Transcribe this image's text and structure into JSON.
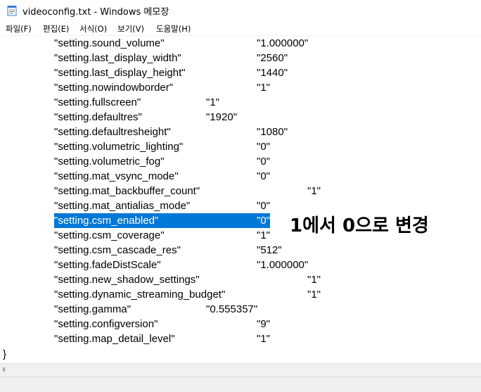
{
  "window": {
    "title": "videoconfig.txt - Windows 메모장",
    "icon": "notepad-icon"
  },
  "menu": [
    {
      "label": "파일(F)"
    },
    {
      "label": "편집(E)"
    },
    {
      "label": "서식(O)"
    },
    {
      "label": "보기(V)"
    },
    {
      "label": "도움말(H)"
    }
  ],
  "editor": {
    "lines": [
      {
        "key": "\"setting.sound_volume\"",
        "value": "\"1.000000\""
      },
      {
        "key": "\"setting.last_display_width\"",
        "value": "\"2560\""
      },
      {
        "key": "\"setting.last_display_height\"",
        "value": "\"1440\""
      },
      {
        "key": "\"setting.nowindowborder\"",
        "value": "\"1\""
      },
      {
        "key": "\"setting.fullscreen\"",
        "value": "\"1\""
      },
      {
        "key": "\"setting.defaultres\"",
        "value": "\"1920\""
      },
      {
        "key": "\"setting.defaultresheight\"",
        "value": "\"1080\""
      },
      {
        "key": "\"setting.volumetric_lighting\"",
        "value": "\"0\""
      },
      {
        "key": "\"setting.volumetric_fog\"",
        "value": "\"0\""
      },
      {
        "key": "\"setting.mat_vsync_mode\"",
        "value": "\"0\""
      },
      {
        "key": "\"setting.mat_backbuffer_count\"",
        "value": "\"1\""
      },
      {
        "key": "\"setting.mat_antialias_mode\"",
        "value": "\"0\""
      },
      {
        "key": "\"setting.csm_enabled\"",
        "value": "\"0\"",
        "selected": true
      },
      {
        "key": "\"setting.csm_coverage\"",
        "value": "\"1\""
      },
      {
        "key": "\"setting.csm_cascade_res\"",
        "value": "\"512\""
      },
      {
        "key": "\"setting.fadeDistScale\"",
        "value": "\"1.000000\""
      },
      {
        "key": "\"setting.new_shadow_settings\"",
        "value": "\"1\""
      },
      {
        "key": "\"setting.dynamic_streaming_budget\"",
        "value": "\"1\""
      },
      {
        "key": "\"setting.gamma\"",
        "value": "\"0.555357\""
      },
      {
        "key": "\"setting.configversion\"",
        "value": "\"9\""
      },
      {
        "key": "\"setting.map_detail_level\"",
        "value": "\"1\""
      }
    ],
    "closing_brace": "}",
    "selection_color": "#0078d7"
  },
  "annotation": {
    "text": "1에서 0으로 변경"
  }
}
